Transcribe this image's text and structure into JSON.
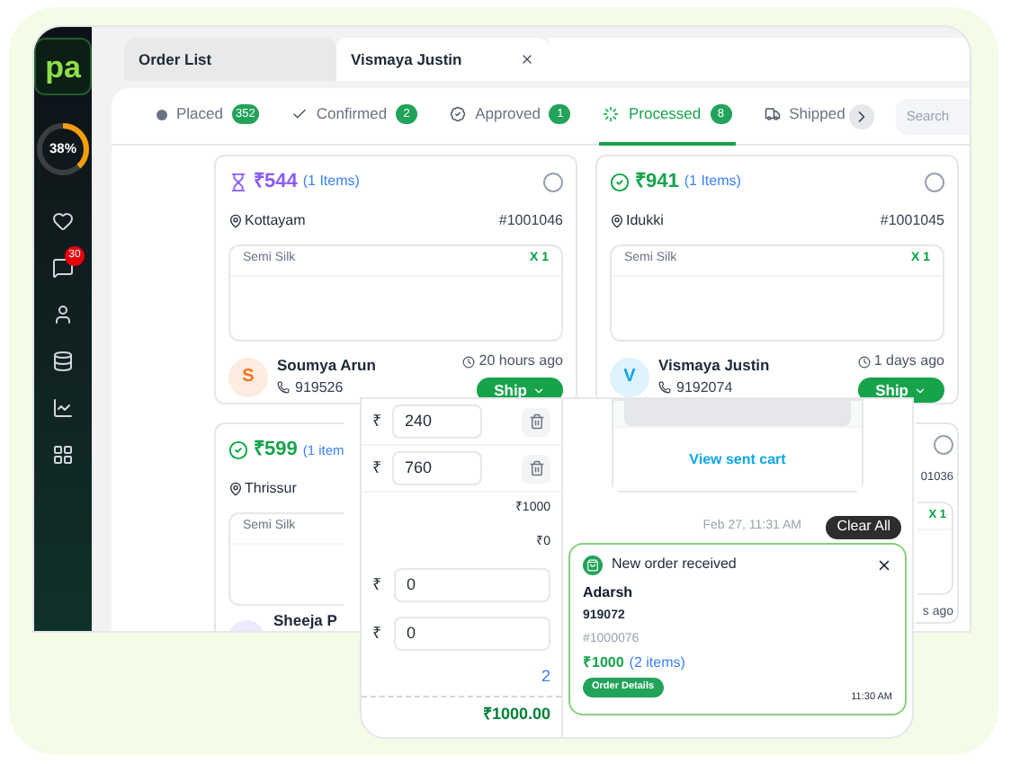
{
  "sidebar": {
    "logo": "pa",
    "progress": {
      "level": 0.38,
      "label": "38%"
    },
    "chat_badge": "30"
  },
  "tabs": [
    {
      "label": "Order List",
      "selected": true,
      "closable": false
    },
    {
      "label": "Vismaya Justin",
      "selected": false,
      "closable": true
    }
  ],
  "status_tabs": [
    {
      "label": "Placed",
      "count": "352",
      "selected": false
    },
    {
      "label": "Confirmed",
      "count": "2",
      "selected": false
    },
    {
      "label": "Approved",
      "count": "1",
      "selected": false
    },
    {
      "label": "Processed",
      "count": "8",
      "selected": true
    },
    {
      "label": "Shipped",
      "selected": false
    }
  ],
  "search": {
    "placeholder": "Search"
  },
  "orders": [
    {
      "kind": "full",
      "confirmed": false,
      "selected": false,
      "amount": "₹544",
      "items": "(1 Items)",
      "location": "Kottayam",
      "order_no": "#1001046",
      "product": "Semi Silk",
      "qty": "X 1",
      "initial": "S",
      "color": "#f97316",
      "name": "Soumya Arun",
      "phone": "919526",
      "time": "20 hours ago",
      "action": "Ship"
    },
    {
      "kind": "full",
      "confirmed": true,
      "selected": false,
      "amount": "₹941",
      "items": "(1 Items)",
      "location": "Idukki",
      "order_no": "#1001045",
      "product": "Semi Silk",
      "qty": "X 1",
      "initial": "V",
      "color": "#0ea5e9",
      "name": "Vismaya Justin",
      "phone": "9192074",
      "time": "1 days ago",
      "action": "Ship"
    },
    {
      "kind": "cut_left",
      "confirmed": true,
      "amount": "₹599",
      "items": "(1 item",
      "location": "Thrissur",
      "product": "Semi Silk",
      "name": "Sheeja P"
    },
    {
      "kind": "cut_right",
      "selected": false,
      "order_no": "01036",
      "qty": "X 1",
      "time": "s ago"
    }
  ],
  "payment": {
    "rows": [
      {
        "kind": "split",
        "currency": "₹",
        "value": "240"
      },
      {
        "kind": "split",
        "currency": "₹",
        "value": "760"
      },
      {
        "kind": "amount",
        "value": "₹1000"
      },
      {
        "kind": "amount",
        "value": "₹0"
      },
      {
        "kind": "input",
        "currency": "₹",
        "value": "0"
      },
      {
        "kind": "input",
        "currency": "₹",
        "value": "0"
      },
      {
        "kind": "count",
        "value": "2"
      },
      {
        "kind": "total",
        "value": "₹1000.00"
      }
    ]
  },
  "chat": {
    "cart_link": "View sent cart",
    "date": "Feb 27, 11:31 AM",
    "clear_button": "Clear All",
    "notification": {
      "title": "New order received",
      "name": "Adarsh",
      "phone": "919072",
      "order_no": "#1000076",
      "amount": "₹1000",
      "items": "(2 items)",
      "button": "Order Details",
      "time": "11:30 AM"
    }
  }
}
